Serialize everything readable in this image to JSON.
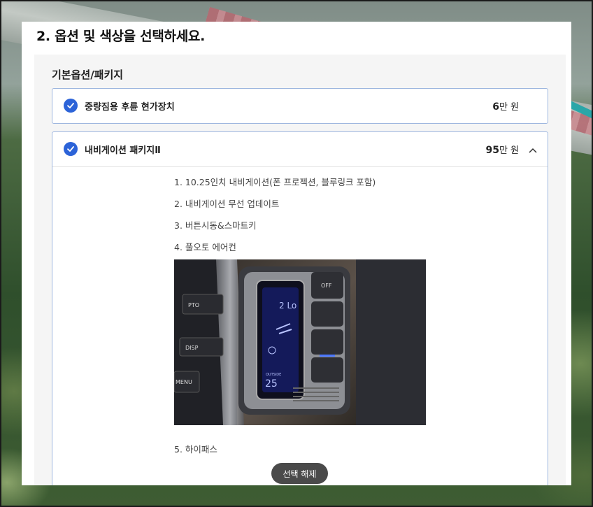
{
  "section": {
    "title": "2. 옵션 및 색상을 선택하세요."
  },
  "group": {
    "title": "기본옵션/패키지"
  },
  "options": [
    {
      "name": "중량짐용 후륜 현가장치",
      "price_number": "6",
      "price_unit": "만 원",
      "checked": true,
      "expanded": false
    },
    {
      "name": "내비게이션 패키지Ⅱ",
      "price_number": "95",
      "price_unit": "만 원",
      "checked": true,
      "expanded": true,
      "details": [
        "1. 10.25인치 내비게이션(폰 프로젝션, 블루링크 포함)",
        "2. 내비게이션 무선 업데이트",
        "3. 버튼시동&스마트키",
        "4. 풀오토 에어컨"
      ],
      "photo_readouts": {
        "temp": "2 Lo",
        "outside_label": "OUTSIDE",
        "outside_temp": "25",
        "off": "OFF",
        "pto": "PTO",
        "disp": "DISP",
        "menu": "MENU"
      },
      "detail_last": "5. 하이패스"
    }
  ],
  "actions": {
    "deselect": "선택 해제"
  },
  "colors": {
    "accent": "#2c63d8",
    "border": "#9db6df"
  },
  "icons": {
    "check": "check-circle-icon",
    "collapse": "chevron-up-icon"
  }
}
